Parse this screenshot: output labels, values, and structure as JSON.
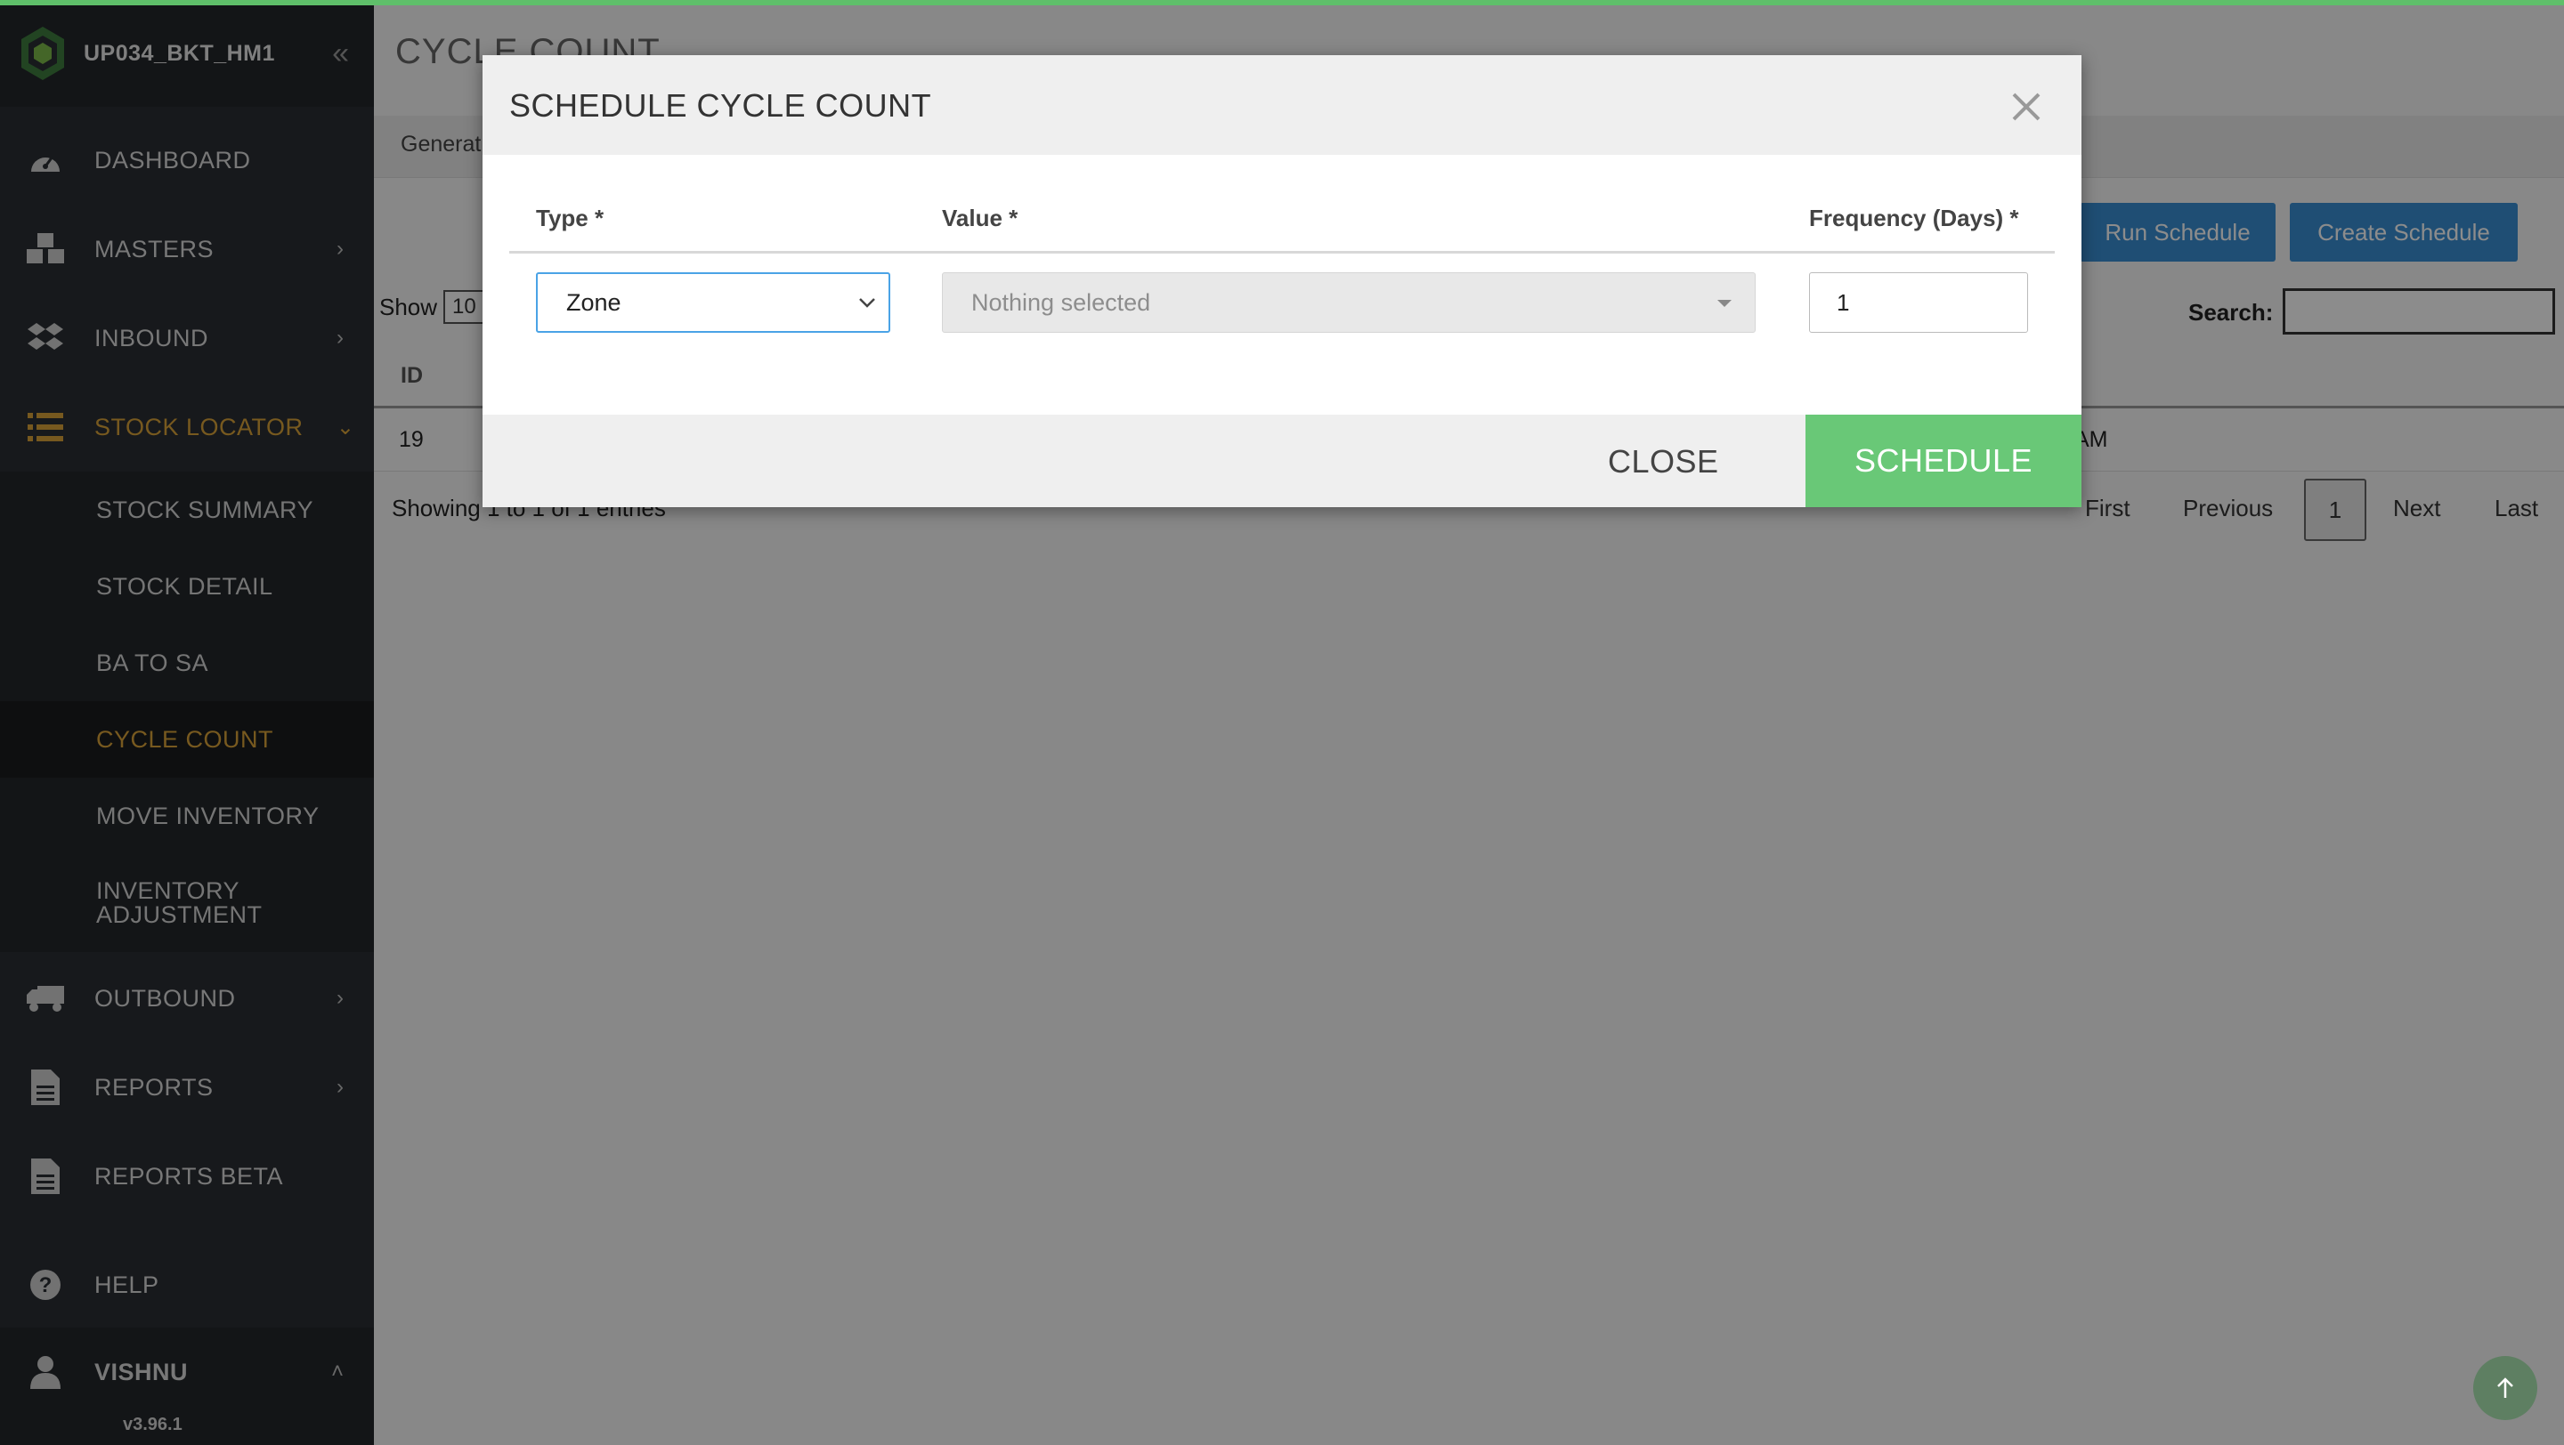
{
  "app": {
    "name": "UP034_BKT_HM1",
    "version": "v3.96.1",
    "accent_color": "#5fbf6a",
    "active_color": "#d9a33a"
  },
  "sidebar": {
    "items": [
      {
        "label": "DASHBOARD",
        "icon": "dashboard-icon"
      },
      {
        "label": "MASTERS",
        "icon": "cubes-icon"
      },
      {
        "label": "INBOUND",
        "icon": "dropbox-icon"
      },
      {
        "label": "STOCK LOCATOR",
        "icon": "list-icon"
      },
      {
        "label": "OUTBOUND",
        "icon": "truck-icon"
      },
      {
        "label": "REPORTS",
        "icon": "file-icon"
      },
      {
        "label": "REPORTS BETA",
        "icon": "file-icon"
      },
      {
        "label": "HELP",
        "icon": "question-icon"
      }
    ],
    "submenu": [
      {
        "label": "STOCK SUMMARY"
      },
      {
        "label": "STOCK DETAIL"
      },
      {
        "label": "BA TO SA"
      },
      {
        "label": "CYCLE COUNT"
      },
      {
        "label": "MOVE INVENTORY"
      },
      {
        "label": "INVENTORY"
      },
      {
        "label": "ADJUSTMENT"
      }
    ],
    "user": "VISHNU"
  },
  "main": {
    "title": "CYCLE COUNT",
    "tab_general": "Generat",
    "run_schedule": "Run Schedule",
    "create_schedule": "Create Schedule",
    "show_label": "Show",
    "show_value": "10",
    "search_label": "Search:",
    "table": {
      "id_header": "ID",
      "rows": [
        {
          "id": "19",
          "time_fragment": "AM"
        }
      ]
    },
    "showing": "Showing 1 to 1 of 1 entries",
    "pagination": {
      "first": "First",
      "previous": "Previous",
      "current": "1",
      "next": "Next",
      "last": "Last"
    }
  },
  "modal": {
    "title": "SCHEDULE CYCLE COUNT",
    "type_label": "Type *",
    "value_label": "Value *",
    "frequency_label": "Frequency (Days) *",
    "type_value": "Zone",
    "value_placeholder": "Nothing selected",
    "frequency_value": "1",
    "close_label": "CLOSE",
    "schedule_label": "SCHEDULE",
    "schedule_color": "#69c877"
  }
}
